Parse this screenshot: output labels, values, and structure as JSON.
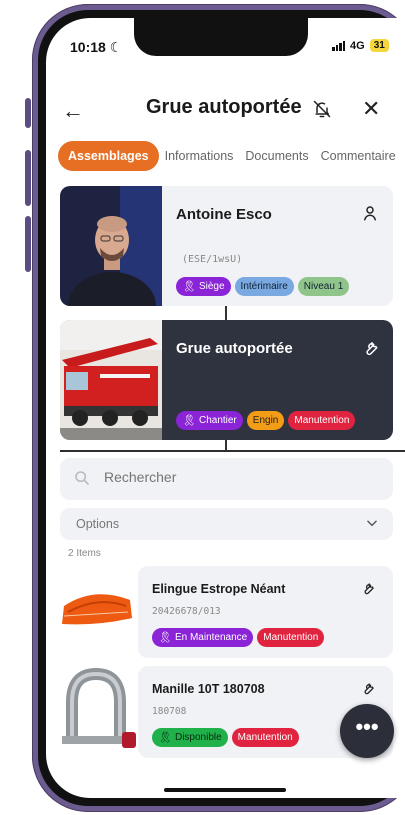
{
  "status_bar": {
    "time": "10:18",
    "network": "4G",
    "battery": "31"
  },
  "header": {
    "title": "Grue autoportée"
  },
  "tabs": [
    {
      "label": "Assemblages",
      "active": true
    },
    {
      "label": "Informations"
    },
    {
      "label": "Documents"
    },
    {
      "label": "Commentaire"
    }
  ],
  "person_card": {
    "name": "Antoine Esco",
    "code": "(ESE/1wsU)",
    "badges": [
      "Siège",
      "Intérimaire",
      "Niveau 1"
    ]
  },
  "crane_card": {
    "name": "Grue autoportée",
    "badges": [
      "Chantier",
      "Engin",
      "Manutention"
    ]
  },
  "search": {
    "placeholder": "Rechercher"
  },
  "options": {
    "label": "Options"
  },
  "items_count": "2 Items",
  "items": [
    {
      "name": "Elingue Estrope Néant",
      "code": "20426678/013",
      "status": "En Maintenance",
      "category": "Manutention"
    },
    {
      "name": "Manille 10T 180708",
      "code": "180708",
      "status": "Disponible",
      "category": "Manutention"
    }
  ],
  "fab": {
    "label": "•••"
  },
  "colors": {
    "accent": "#e66f24",
    "purple": "#8a24d6",
    "red": "#e0233f",
    "green": "#20b14a",
    "dark_card": "#2f3340"
  }
}
